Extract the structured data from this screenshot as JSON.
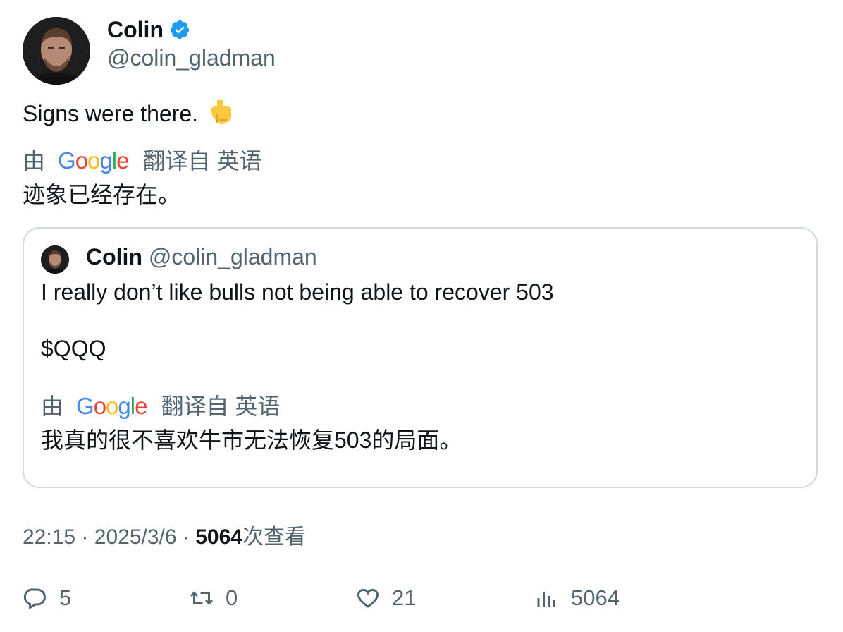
{
  "author": {
    "name": "Colin",
    "handle": "@colin_gladman",
    "verified": true,
    "verified_color": "#1d9bf0"
  },
  "tweet": {
    "text": "Signs were there.",
    "emoji": "👇",
    "translation": {
      "prefix": "由",
      "provider": "Google",
      "suffix": "翻译自 英语",
      "text": "迹象已经存在。"
    }
  },
  "quote": {
    "name": "Colin",
    "handle": "@colin_gladman",
    "text_line1": "I really don’t like bulls not being able to recover 503",
    "text_line2": "$QQQ",
    "translation": {
      "prefix": "由",
      "provider": "Google",
      "suffix": "翻译自 英语",
      "text": "我真的很不喜欢牛市无法恢复503的局面。"
    }
  },
  "meta": {
    "time": "22:15",
    "separator": "·",
    "date": "2025/3/6",
    "views_count": "5064",
    "views_label": "次查看"
  },
  "actions": {
    "replies": "5",
    "retweets": "0",
    "likes": "21",
    "views": "5064"
  },
  "icons": {
    "reply": "reply-icon",
    "retweet": "retweet-icon",
    "like": "heart-icon",
    "views": "bar-chart-icon",
    "verified": "verified-badge-icon"
  },
  "colors": {
    "text": "#0f1419",
    "muted": "#536471",
    "border": "#cfd9de"
  }
}
